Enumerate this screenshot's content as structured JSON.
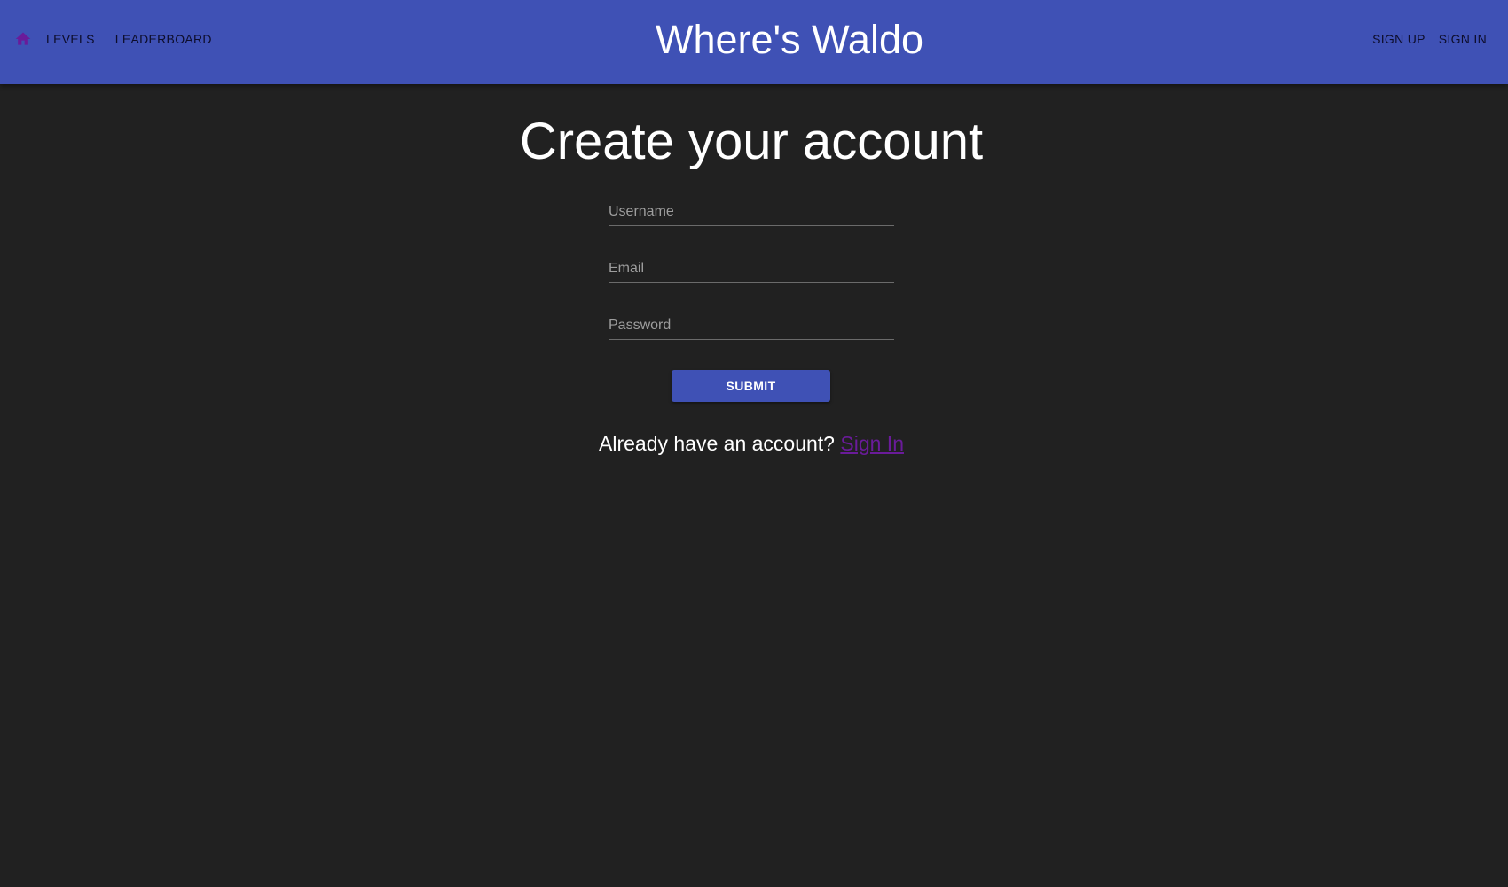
{
  "header": {
    "home_icon": "home-icon",
    "home_icon_color": "#6a1b9a",
    "levels_label": "Levels",
    "leaderboard_label": "Leaderboard",
    "title": "Where's Waldo",
    "sign_up_label": "Sign Up",
    "sign_in_label": "Sign In",
    "background_color": "#3f51b5"
  },
  "main": {
    "title": "Create your account",
    "fields": {
      "username": {
        "label": "Username",
        "value": ""
      },
      "email": {
        "label": "Email",
        "value": ""
      },
      "password": {
        "label": "Password",
        "value": ""
      }
    },
    "submit_label": "Submit",
    "signin_prompt": "Already have an account?",
    "signin_link": "Sign In",
    "background_color": "#212121",
    "link_color": "#6a1b9a"
  }
}
